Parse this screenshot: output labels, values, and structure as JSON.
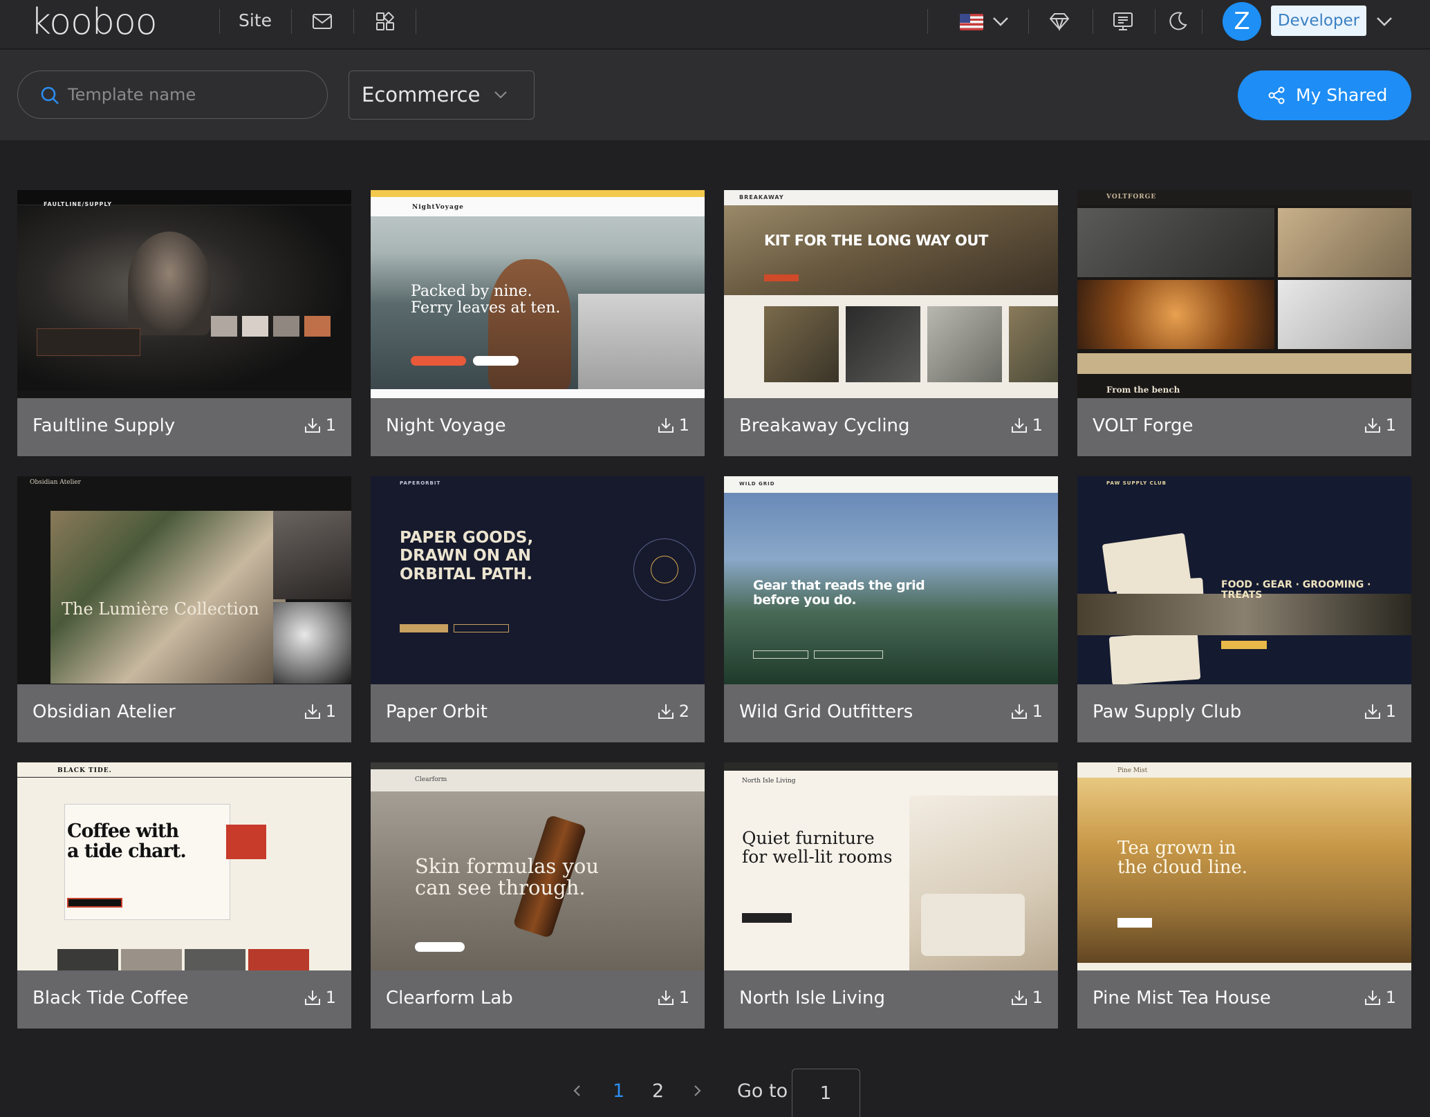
{
  "header": {
    "logo": "kooboo",
    "nav_site": "Site",
    "avatar_initial": "Z",
    "role_button": "Developer"
  },
  "filters": {
    "search_placeholder": "Template name",
    "search_value": "",
    "category_selected": "Ecommerce",
    "shared_button": "My Shared"
  },
  "templates": [
    {
      "name": "Faultline Supply",
      "downloads": "1",
      "brand": "FAULTLINE/SUPPLY"
    },
    {
      "name": "Night Voyage",
      "downloads": "1",
      "brand": "NightVoyage",
      "hero": "Packed by nine.\nFerry leaves at ten."
    },
    {
      "name": "Breakaway Cycling",
      "downloads": "1",
      "brand": "BREAKAWAY",
      "hero": "KIT FOR THE LONG WAY OUT"
    },
    {
      "name": "VOLT Forge",
      "downloads": "1",
      "brand": "VOLTFORGE",
      "hero": "From the bench"
    },
    {
      "name": "Obsidian Atelier",
      "downloads": "1",
      "brand": "Obsidian Atelier",
      "hero": "The Lumière Collection"
    },
    {
      "name": "Paper Orbit",
      "downloads": "2",
      "brand": "PAPERORBIT",
      "hero": "PAPER GOODS,\nDRAWN ON AN\nORBITAL PATH."
    },
    {
      "name": "Wild Grid Outfitters",
      "downloads": "1",
      "brand": "WILD GRID",
      "hero": "Gear that reads the grid\nbefore you do."
    },
    {
      "name": "Paw Supply Club",
      "downloads": "1",
      "brand": "PAW SUPPLY CLUB",
      "hero": "FOOD · GEAR · GROOMING ·\nTREATS"
    },
    {
      "name": "Black Tide Coffee",
      "downloads": "1",
      "brand": "BLACK TIDE.",
      "hero": "Coffee with\na tide chart."
    },
    {
      "name": "Clearform Lab",
      "downloads": "1",
      "brand": "Clearform",
      "hero": "Skin formulas you\ncan see through."
    },
    {
      "name": "North Isle Living",
      "downloads": "1",
      "brand": "North Isle Living",
      "hero": "Quiet furniture\nfor well-lit rooms"
    },
    {
      "name": "Pine Mist Tea House",
      "downloads": "1",
      "brand": "Pine Mist",
      "hero": "Tea grown in\nthe cloud line."
    }
  ],
  "pagination": {
    "pages": [
      "1",
      "2"
    ],
    "current": "1",
    "goto_label": "Go to",
    "goto_value": "1"
  },
  "colors": {
    "accent": "#1e8df5",
    "background": "#202022",
    "card_footer": "#67676a"
  }
}
